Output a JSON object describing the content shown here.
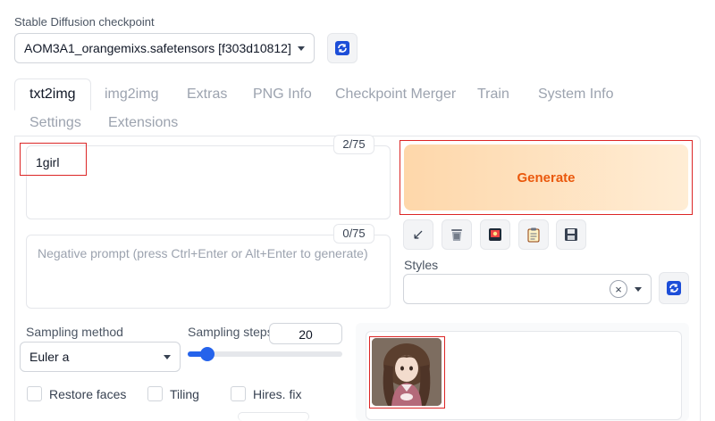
{
  "checkpoint": {
    "label": "Stable Diffusion checkpoint",
    "value": "AOM3A1_orangemixs.safetensors [f303d10812]",
    "refresh_icon": "refresh-icon"
  },
  "tabs": [
    {
      "label": "txt2img"
    },
    {
      "label": "img2img"
    },
    {
      "label": "Extras"
    },
    {
      "label": "PNG Info"
    },
    {
      "label": "Checkpoint Merger"
    },
    {
      "label": "Train"
    },
    {
      "label": "System Info"
    },
    {
      "label": "Settings"
    },
    {
      "label": "Extensions"
    }
  ],
  "prompt": {
    "value": "1girl",
    "counter": "2/75"
  },
  "negative_prompt": {
    "placeholder": "Negative prompt (press Ctrl+Enter or Alt+Enter to generate)",
    "counter": "0/75"
  },
  "generate": {
    "label": "Generate",
    "color": "#ea580c"
  },
  "tools": [
    {
      "icon": "arrow-down-left-icon",
      "glyph": "↙"
    },
    {
      "icon": "trash-icon",
      "glyph": ""
    },
    {
      "icon": "picture-card-icon",
      "glyph": ""
    },
    {
      "icon": "clipboard-icon",
      "glyph": ""
    },
    {
      "icon": "save-icon",
      "glyph": ""
    }
  ],
  "styles": {
    "label": "Styles",
    "clear": "×"
  },
  "sampling": {
    "method_label": "Sampling method",
    "method_value": "Euler a",
    "steps_label": "Sampling steps",
    "steps_value": "20",
    "steps_fraction": 0.13
  },
  "options": {
    "restore_faces": "Restore faces",
    "tiling": "Tiling",
    "hires_fix": "Hires. fix"
  },
  "colors": {
    "accent": "#2563eb",
    "highlight": "#dc2626",
    "generate_bg": "#fed7aa"
  }
}
